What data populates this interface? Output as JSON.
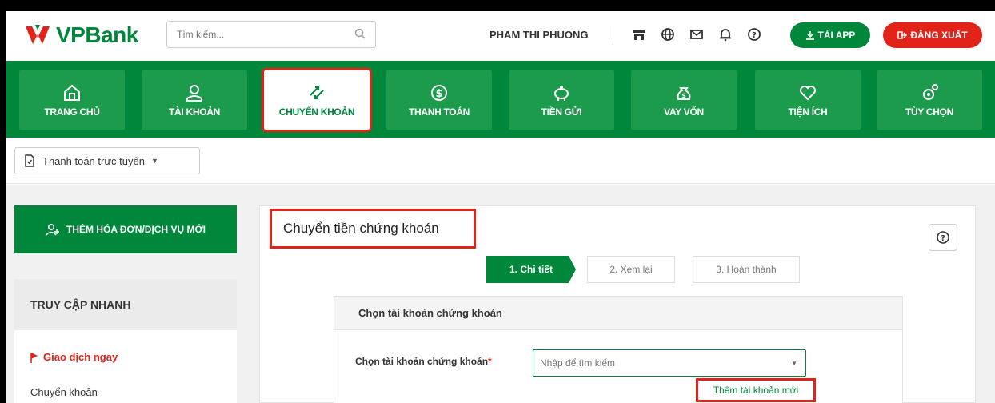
{
  "header": {
    "brand": "VPBank",
    "search_placeholder": "Tìm kiếm...",
    "user_name": "PHAM THI PHUONG",
    "icons": [
      "store-icon",
      "globe-icon",
      "mail-icon",
      "bell-icon",
      "help-icon"
    ],
    "app_label": "TẢI APP",
    "logout_label": "ĐĂNG XUẤT"
  },
  "nav": {
    "items": [
      {
        "label": "TRANG CHỦ",
        "icon": "home-icon"
      },
      {
        "label": "TÀI KHOẢN",
        "icon": "user-icon"
      },
      {
        "label": "CHUYỂN KHOẢN",
        "icon": "transfer-icon",
        "active": true
      },
      {
        "label": "THANH TOÁN",
        "icon": "dollar-icon"
      },
      {
        "label": "TIỀN GỬI",
        "icon": "piggy-icon"
      },
      {
        "label": "VAY VỐN",
        "icon": "money-bag-icon"
      },
      {
        "label": "TIỆN ÍCH",
        "icon": "heart-icon"
      },
      {
        "label": "TÙY CHỌN",
        "icon": "settings-icon"
      }
    ]
  },
  "subbar": {
    "dropdown_label": "Thanh toán trực tuyến"
  },
  "sidebar": {
    "add_button": "THÊM HÓA ĐƠN/DỊCH VỤ MỚI",
    "quick_title": "TRUY CẬP NHANH",
    "quick_highlight": "Giao dịch ngay",
    "quick_item": "Chuyển khoản"
  },
  "panel": {
    "title": "Chuyển tiền chứng khoán",
    "steps": [
      "1. Chi tiết",
      "2. Xem lại",
      "3. Hoàn thành"
    ],
    "form_title": "Chọn tài khoản chứng khoán",
    "field_label": "Chọn tài khoản chứng khoán",
    "field_required": "*",
    "field_placeholder": "Nhập để tìm kiếm",
    "add_account_link": "Thêm tài khoản mới"
  },
  "colors": {
    "brand_green": "#00873c",
    "brand_red": "#e2231a"
  }
}
